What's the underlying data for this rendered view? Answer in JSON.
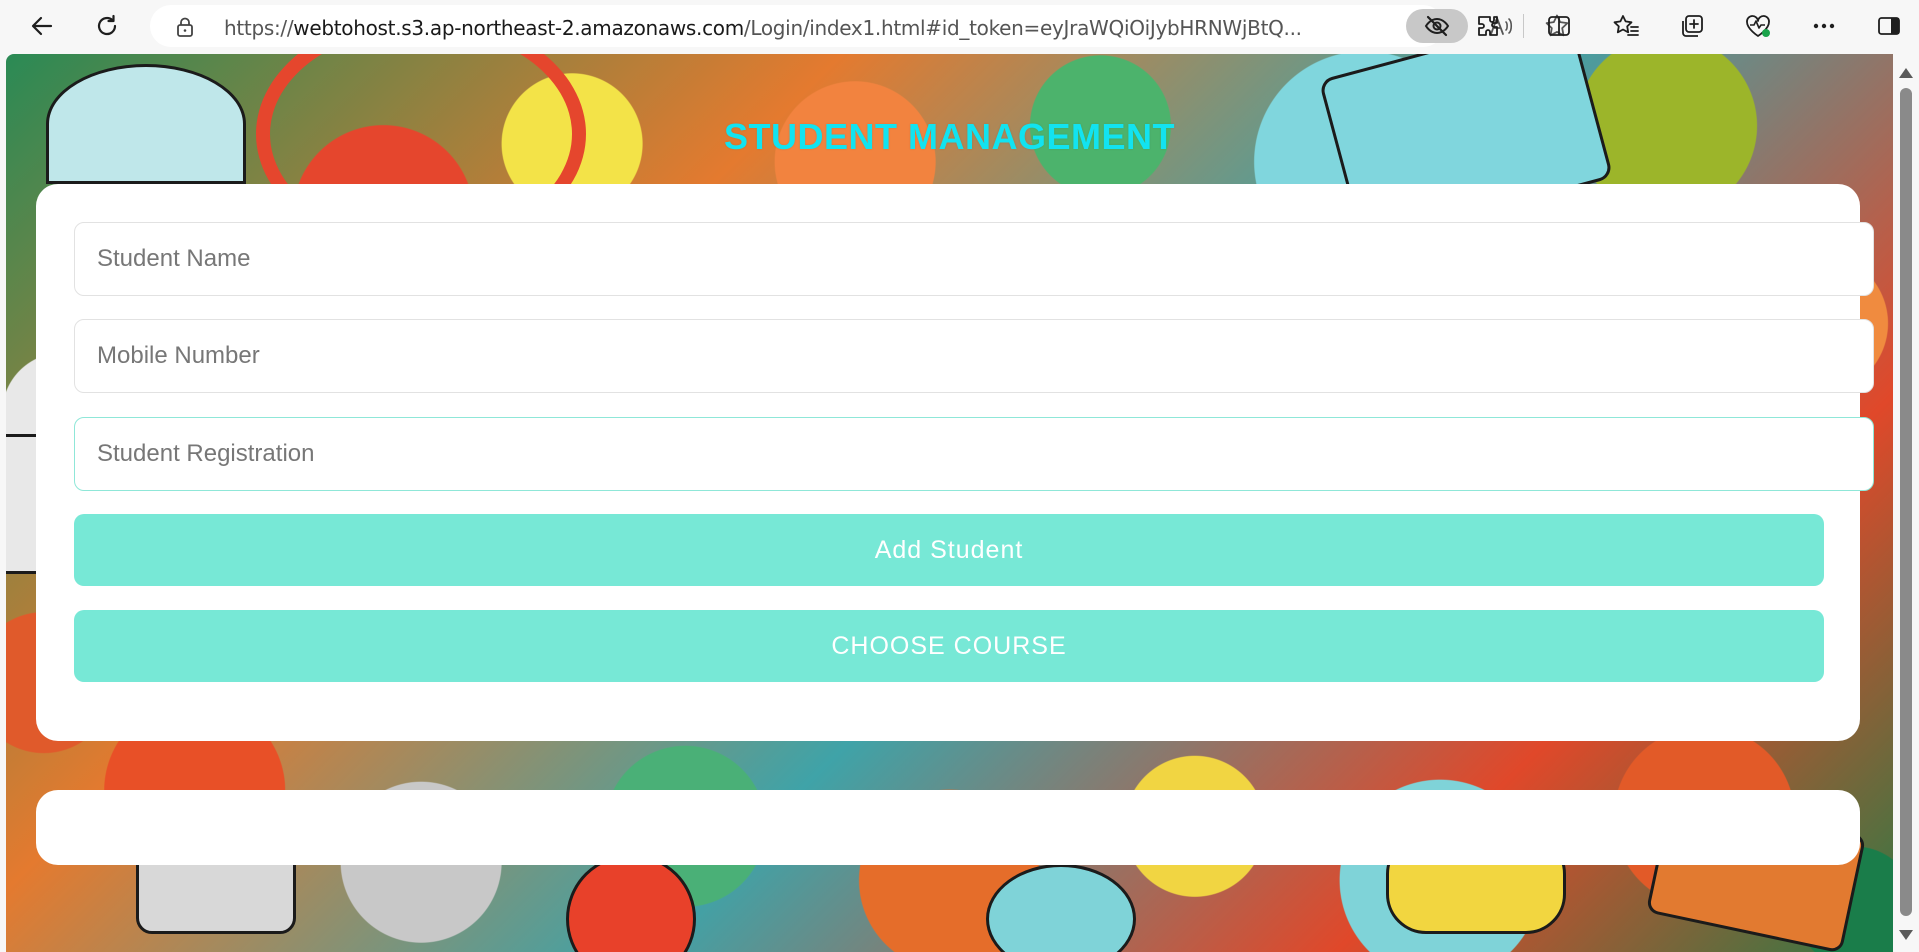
{
  "browser": {
    "url_prefix": "https://",
    "url_host": "webtohost.s3.ap-northeast-2.amazonaws.com",
    "url_rest": "/Login/index1.html#id_token=eyJraWQiOiJybHRNWjBtQ..."
  },
  "page": {
    "title": "STUDENT MANAGEMENT",
    "title_color": "#12e3f0",
    "accent_color": "#77e8d6"
  },
  "form": {
    "student_name_placeholder": "Student Name",
    "mobile_number_placeholder": "Mobile Number",
    "student_registration_placeholder": "Student Registration",
    "add_student_label": "Add Student",
    "choose_course_label": "CHOOSE COURSE"
  }
}
